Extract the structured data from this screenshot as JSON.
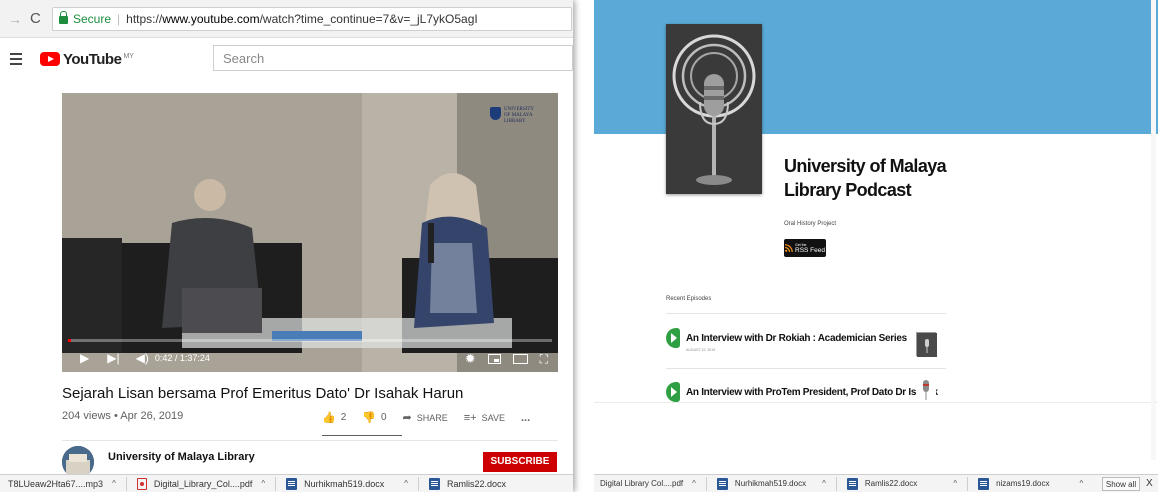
{
  "left_window": {
    "address_bar": {
      "forward_glyph": "→",
      "reload_glyph": "C",
      "secure_label": "Secure",
      "url_prefix": "https://",
      "url_host": "www.youtube.com",
      "url_path": "/watch?time_continue=7&v=_jL7ykO5agI"
    },
    "youtube": {
      "logo_text": "YouTube",
      "region": "MY",
      "search_placeholder": "Search",
      "video": {
        "time": "0:42 / 1:37:24",
        "progress_fraction": 0.0072,
        "watermark_line1": "UNIVERSITY",
        "watermark_line2": "OF MALAYA",
        "watermark_line3": "LIBRARY"
      },
      "title": "Sejarah Lisan bersama Prof Emeritus Dato' Dr Isahak Harun",
      "meta": "204 views • Apr 26, 2019",
      "likes": "2",
      "dislikes": "0",
      "share_label": "SHARE",
      "save_label": "SAVE",
      "more_label": "...",
      "channel_name": "University of Malaya Library",
      "subscribe_label": "SUBSCRIBE"
    },
    "downloads": [
      {
        "name": "T8LUeaw2Hta67....mp3",
        "icon": "none"
      },
      {
        "name": "Digital_Library_Col....pdf",
        "icon": "pdf-icon"
      },
      {
        "name": "Nurhikmah519.docx",
        "icon": "doc-icon"
      },
      {
        "name": "Ramlis22.docx",
        "icon": "doc-icon"
      }
    ],
    "caret": "^"
  },
  "right_window": {
    "banner_color": "#5aa9d6",
    "podcast_title": "University of Malaya Library Podcast",
    "podcast_subtitle": "Oral History Project",
    "rss_label": "RSS Feed",
    "rss_small": "Get the",
    "recent_label": "Recent Episodes",
    "episodes": [
      {
        "title": "An Interview with Dr Rokiah : Academician Series",
        "date": "AUGUST 22, 2019"
      },
      {
        "title": "An Interview with ProTem President, Prof Dato Dr Isahak",
        "date": ""
      }
    ],
    "downloads": [
      {
        "name": "Digital Library Col....pdf",
        "icon": "none"
      },
      {
        "name": "Nurhikmah519.docx",
        "icon": "doc-icon"
      },
      {
        "name": "Ramlis22.docx",
        "icon": "doc-icon"
      },
      {
        "name": "nizams19.docx",
        "icon": "doc-icon"
      }
    ],
    "show_all_label": "Show all",
    "close_label": "X",
    "caret": "^"
  }
}
